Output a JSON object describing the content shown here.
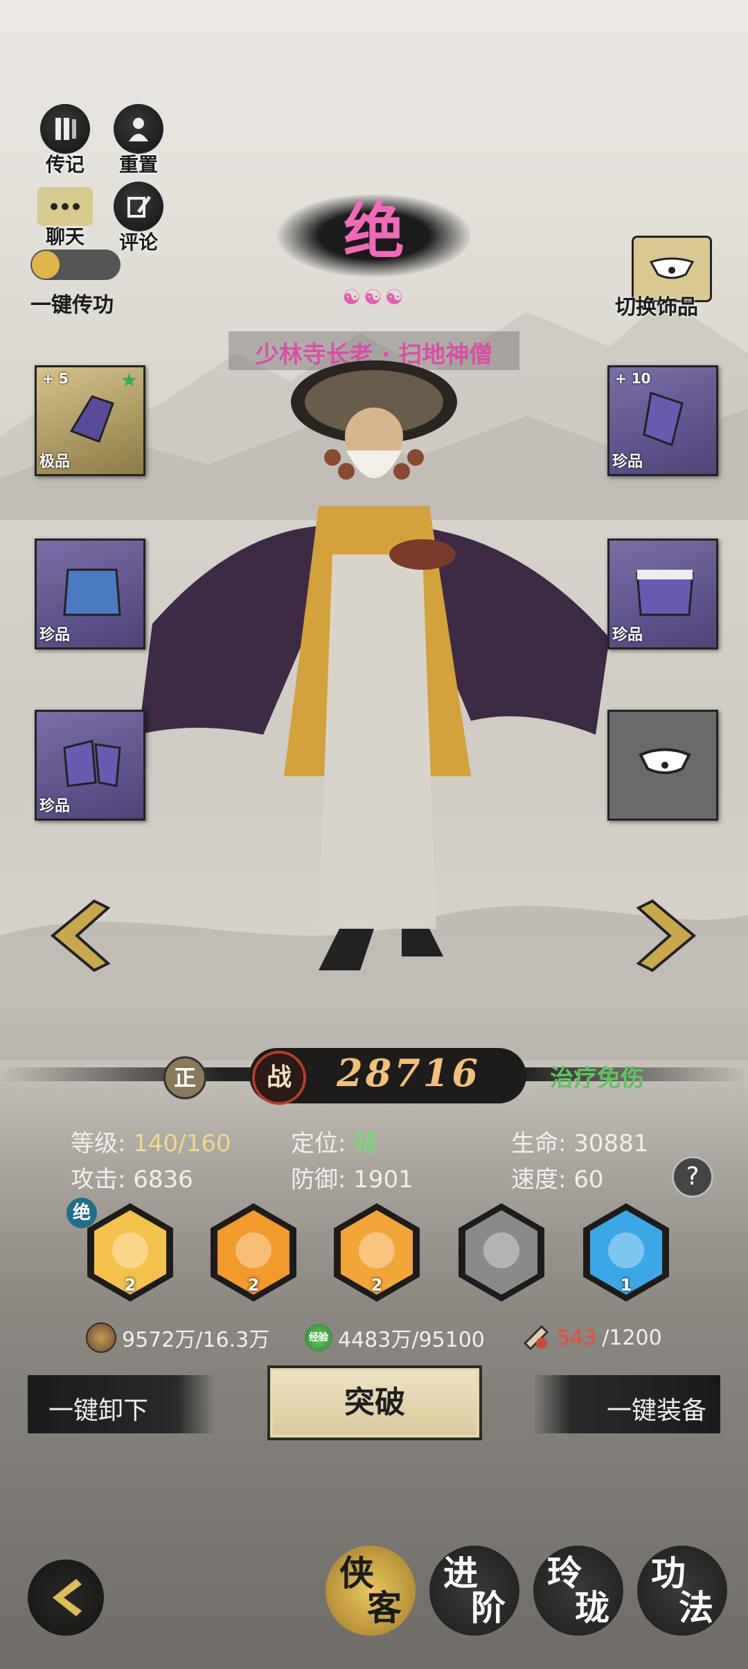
{
  "top_left": {
    "bio_label": "传记",
    "reset_label": "重置",
    "chat_label": "聊天",
    "comment_label": "评论",
    "transfer_label": "一键传功"
  },
  "hero": {
    "grade": "绝",
    "title": "少林寺长老 · 扫地神僧",
    "switch_label": "切换饰品"
  },
  "equipment": {
    "left": [
      {
        "rank": "极品",
        "plus": "+ 5",
        "color": "gold"
      },
      {
        "rank": "珍品",
        "plus": "",
        "color": "purple"
      },
      {
        "rank": "珍品",
        "plus": "",
        "color": "purple"
      }
    ],
    "right": [
      {
        "rank": "珍品",
        "plus": "+ 10",
        "color": "purple"
      },
      {
        "rank": "珍品",
        "plus": "",
        "color": "purple"
      },
      {
        "rank": "",
        "plus": "",
        "color": "empty"
      }
    ]
  },
  "power": {
    "alignment": "正",
    "battle_icon": "战",
    "value": "28716",
    "role_tag": "治疗免伤"
  },
  "stats": {
    "level_label": "等级: ",
    "level_value": "140/160",
    "position_label": "定位: ",
    "position_value": "辅",
    "hp_label": "生命: ",
    "hp_value": "30881",
    "atk_label": "攻击: ",
    "atk_value": "6836",
    "def_label": "防御: ",
    "def_value": "1901",
    "spd_label": "速度: ",
    "spd_value": "60",
    "help": "?"
  },
  "skills": [
    {
      "level": "2",
      "badge": "绝",
      "icon": "buddha-icon",
      "color": "#f3c24a"
    },
    {
      "level": "2",
      "badge": "",
      "icon": "fire-icon",
      "color": "#f29a2a"
    },
    {
      "level": "2",
      "badge": "",
      "icon": "monk-fire-icon",
      "color": "#f3a638"
    },
    {
      "level": "",
      "badge": "",
      "icon": "locked-skill-icon",
      "color": "#8a8a8a"
    },
    {
      "level": "1",
      "badge": "",
      "icon": "vortex-icon",
      "color": "#3aa8e6"
    }
  ],
  "resources": {
    "coins": "9572万/16.3万",
    "exp_label": "经验",
    "exp": "4483万/95100",
    "item_current": "543",
    "item_total": "/1200"
  },
  "actions": {
    "unequip_all": "一键卸下",
    "breakthrough": "突破",
    "equip_all": "一键装备"
  },
  "bottom_nav": {
    "tab1_a": "侠",
    "tab1_b": "客",
    "tab2_a": "进",
    "tab2_b": "阶",
    "tab3_a": "玲",
    "tab3_b": "珑",
    "tab4_a": "功",
    "tab4_b": "法"
  }
}
